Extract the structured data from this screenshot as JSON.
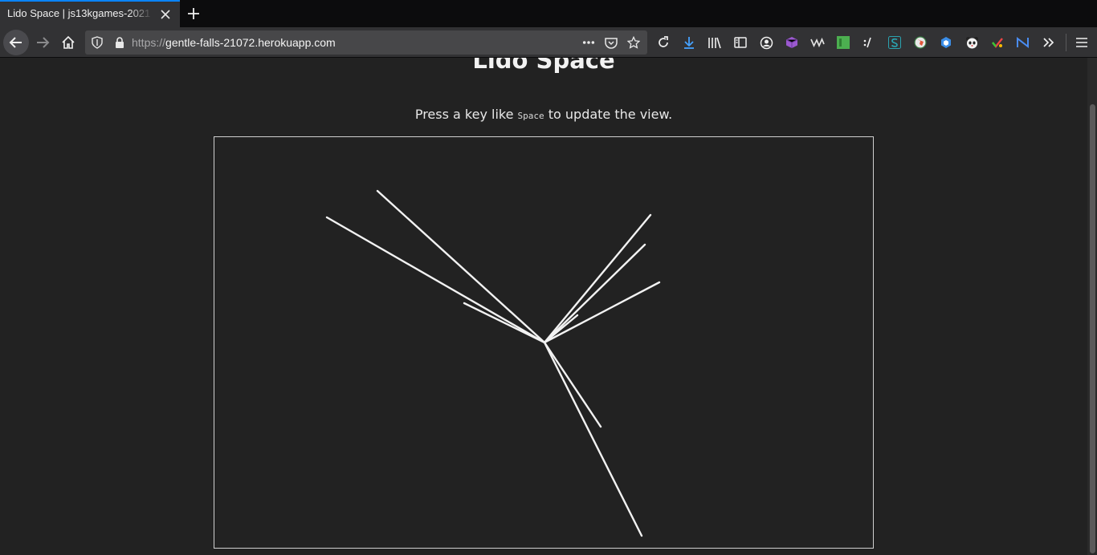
{
  "browser": {
    "tab_title": "Lido Space | js13kgames-2021",
    "url_scheme": "https://",
    "url_host": "gentle-falls-21072.herokuapp.com"
  },
  "page": {
    "title": "Lido Space",
    "instruction_before": "Press a key like ",
    "instruction_key": "Space",
    "instruction_after": " to update the view."
  },
  "canvas": {
    "background": "#222222",
    "border_color": "#d0d0d0",
    "line_color": "#f2f2f2"
  },
  "colors": {
    "accent": "#0a84ff",
    "toolbar": "#323234",
    "urlbar": "#474749"
  },
  "icons": {
    "toolbar": [
      "pocket-icon",
      "bookmark-star-icon",
      "reload-icon",
      "download-icon",
      "library-icon",
      "sidebar-icon",
      "account-icon",
      "extension-cube-icon",
      "extension-wave-icon",
      "extension-green-icon",
      "extension-slash-icon",
      "extension-s-icon",
      "extension-globe-icon",
      "extension-hex-icon",
      "extension-panda-icon",
      "extension-color-icon",
      "extension-n-icon",
      "overflow-chevron-icon",
      "menu-icon"
    ]
  }
}
